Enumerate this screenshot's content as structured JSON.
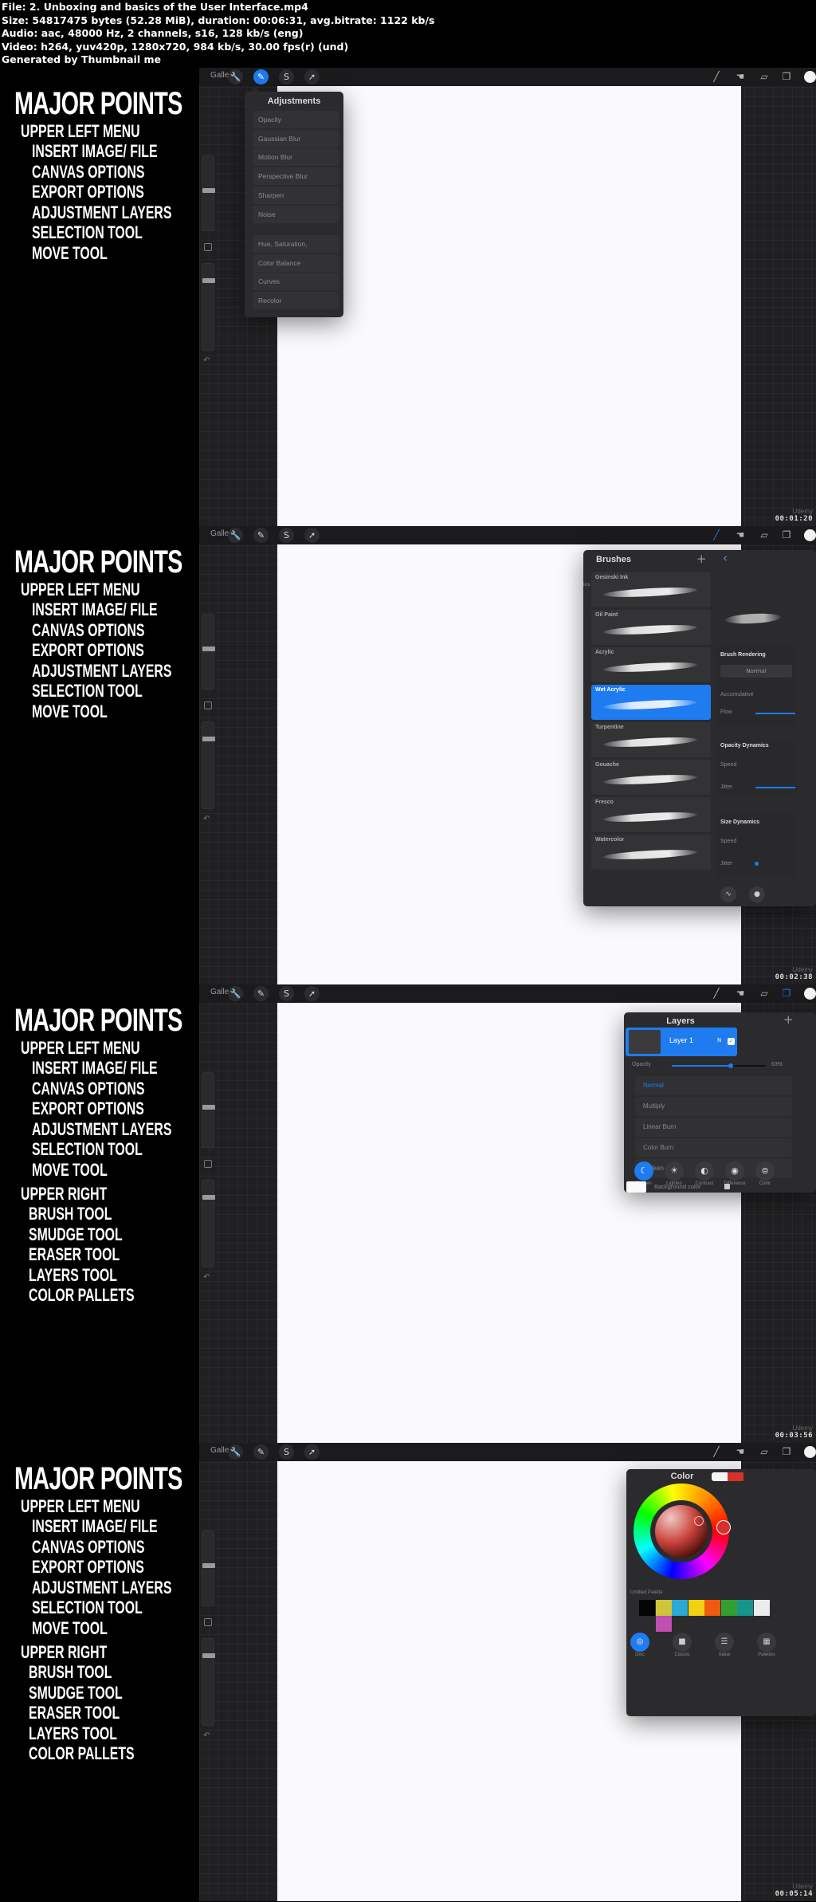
{
  "header": {
    "file": "File: 2. Unboxing and basics of the User Interface.mp4",
    "size": "Size: 54817475 bytes (52.28 MiB), duration: 00:06:31, avg.bitrate: 1122 kb/s",
    "audio": "Audio: aac, 48000 Hz, 2 channels, s16, 128 kb/s (eng)",
    "video": "Video: h264, yuv420p, 1280x720, 984 kb/s, 30.00 fps(r) (und)",
    "generated": "Generated by Thumbnail me"
  },
  "notes": {
    "title": "MAJOR POINTS",
    "upper_left_heading": "UPPER LEFT MENU",
    "upper_left_items": [
      "INSERT IMAGE/ FILE",
      "CANVAS OPTIONS",
      "EXPORT OPTIONS",
      "ADJUSTMENT LAYERS",
      "SELECTION TOOL",
      "MOVE TOOL"
    ],
    "upper_right_heading": "UPPER RIGHT",
    "upper_right_items": [
      "BRUSH TOOL",
      "SMUDGE TOOL",
      "ERASER TOOL",
      "LAYERS TOOL",
      "COLOR PALLETS"
    ]
  },
  "toolbar": {
    "gallery_label": "Gallery",
    "left_tools": [
      {
        "name": "actions",
        "icon": "wrench-icon",
        "glyph": "🔧"
      },
      {
        "name": "adjustments",
        "icon": "magic-wand-icon",
        "glyph": "✎"
      },
      {
        "name": "selection",
        "icon": "selection-s-icon",
        "glyph": "S"
      },
      {
        "name": "move",
        "icon": "arrow-cursor-icon",
        "glyph": "➚"
      }
    ],
    "right_tools": [
      {
        "name": "brush",
        "icon": "brush-icon",
        "glyph": "╱"
      },
      {
        "name": "smudge",
        "icon": "smudge-finger-icon",
        "glyph": "☚"
      },
      {
        "name": "eraser",
        "icon": "eraser-icon",
        "glyph": "▱"
      },
      {
        "name": "layers",
        "icon": "layers-icon",
        "glyph": "❐"
      }
    ],
    "undo_glyph": "↶"
  },
  "watermark": {
    "brand": "Udemy"
  },
  "frames": [
    {
      "timestamp": "00:01:20"
    },
    {
      "timestamp": "00:02:38"
    },
    {
      "timestamp": "00:03:56"
    },
    {
      "timestamp": "00:05:14"
    }
  ],
  "adjustments": {
    "title": "Adjustments",
    "group1": [
      "Opacity",
      "Gaussian Blur",
      "Motion Blur",
      "Perspective Blur",
      "Sharpen",
      "Noise"
    ],
    "group2": [
      "Hue, Saturation, Brightness",
      "Color Balance",
      "Curves",
      "Recolor"
    ]
  },
  "brushes": {
    "title": "Brushes",
    "add_glyph": "+",
    "back_glyph": "‹",
    "set_label": "ios",
    "items": [
      "Gesinski Ink",
      "Oil Paint",
      "Acrylic",
      "Wet Acrylic",
      "Turpentine",
      "Gouache",
      "Fresco",
      "Watercolor"
    ],
    "selected": "Wet Acrylic",
    "settings": {
      "brush_rendering": "Brush Rendering",
      "rendering_mode": "Normal",
      "accumulative": "Accumulative",
      "flow": "Flow",
      "opacity_dynamics": "Opacity Dynamics",
      "size_dynamics": "Size Dynamics",
      "speed": "Speed",
      "jitter": "Jitter"
    }
  },
  "layers": {
    "title": "Layers",
    "add_glyph": "+",
    "layer_name": "Layer 1",
    "blend_letter": "N",
    "opacity_label": "Opacity",
    "opacity_value": "63%",
    "opacity_fraction": 0.63,
    "blend_modes": [
      "Normal",
      "Multiply",
      "Linear Burn",
      "Color Burn",
      "Darken"
    ],
    "selected_blend": "Normal",
    "mode_groups": [
      {
        "label": "Darken",
        "glyph": "☾"
      },
      {
        "label": "Lighten",
        "glyph": "☀"
      },
      {
        "label": "Contrast",
        "glyph": "◐"
      },
      {
        "label": "Difference",
        "glyph": "◉"
      },
      {
        "label": "Color",
        "glyph": "⊜"
      }
    ],
    "background_label": "Background color"
  },
  "color": {
    "title": "Color",
    "primary": "#d4322a",
    "secondary": "#f4f4f4",
    "palette_label": "Untitled Palette",
    "swatches": [
      "#050505",
      "#cfc43a",
      "#2ba9d6",
      "#f0d114",
      "#ef5b0c",
      "#32a02e",
      "#17948b",
      "#ececec",
      "#c04fb0"
    ],
    "tabs": [
      {
        "label": "Disc",
        "glyph": "◎"
      },
      {
        "label": "Classic",
        "glyph": "■"
      },
      {
        "label": "Value",
        "glyph": "☰"
      },
      {
        "label": "Palettes",
        "glyph": "▦"
      }
    ],
    "selected_tab": "Disc"
  }
}
